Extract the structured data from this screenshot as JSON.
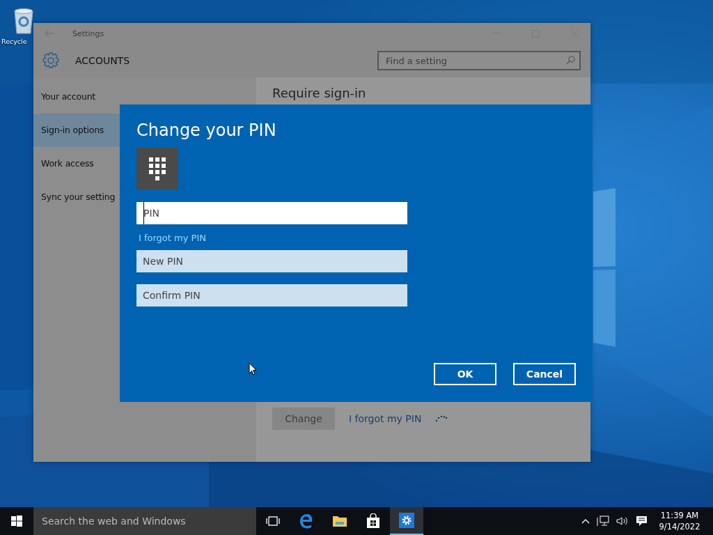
{
  "desktop": {
    "icons": [
      {
        "label": "Recycle"
      }
    ]
  },
  "settings_window": {
    "title": "Settings",
    "section": "ACCOUNTS",
    "search": {
      "placeholder": "Find a setting"
    },
    "sidebar": {
      "items": [
        {
          "label": "Your account",
          "selected": false
        },
        {
          "label": "Sign-in options",
          "selected": true
        },
        {
          "label": "Work access",
          "selected": false
        },
        {
          "label": "Sync your setting",
          "selected": false
        }
      ]
    },
    "content": {
      "heading": "Require sign-in",
      "change_button": {
        "label": "Change",
        "disabled": true
      },
      "forgot_link": "I forgot my PIN"
    }
  },
  "dialog": {
    "title": "Change your PIN",
    "fields": [
      {
        "placeholder": "PIN",
        "focused": true
      },
      {
        "kind": "link",
        "label": "I forgot my PIN"
      },
      {
        "placeholder": "New PIN",
        "focused": false
      },
      {
        "placeholder": "Confirm PIN",
        "focused": false
      }
    ],
    "buttons": [
      "OK",
      "Cancel"
    ]
  },
  "taskbar": {
    "search": {
      "placeholder": "Search the web and Windows"
    },
    "apps": [
      {
        "kind": "task-view",
        "selected": false
      },
      {
        "kind": "browser",
        "selected": false
      },
      {
        "kind": "folder",
        "selected": false
      },
      {
        "kind": "store",
        "selected": false
      },
      {
        "kind": "settings",
        "selected": true
      }
    ],
    "clock": {
      "time": "11:39 AM",
      "date": "9/14/2022"
    }
  }
}
